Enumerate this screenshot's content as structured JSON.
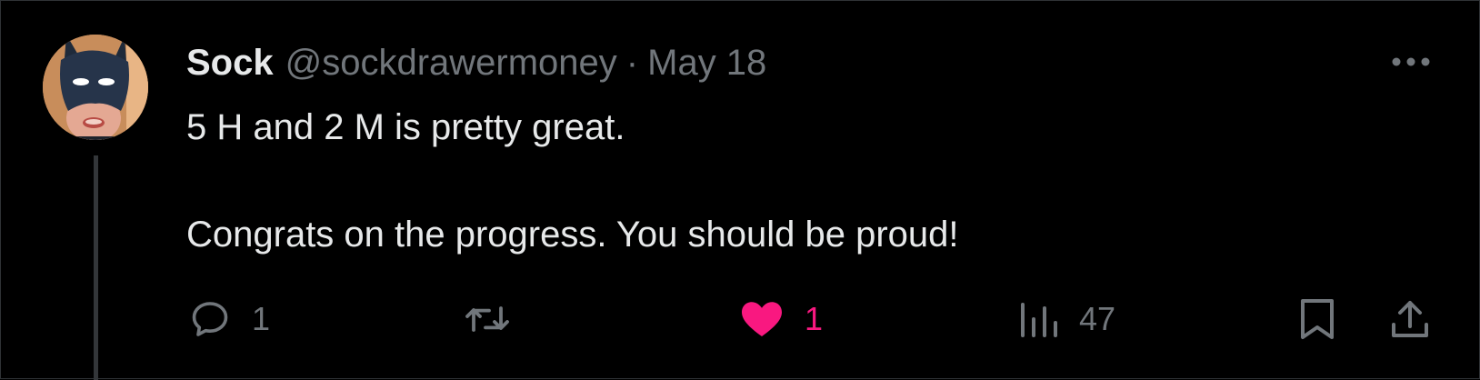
{
  "tweet": {
    "author": {
      "display_name": "Sock",
      "handle": "@sockdrawermoney",
      "avatar_icon": "masked-face-avatar"
    },
    "separator": "·",
    "date": "May 18",
    "text_lines": [
      "5 H and 2 M is pretty great.",
      "Congrats on the progress. You should be proud!"
    ],
    "actions": {
      "reply": {
        "icon": "speech-bubble-icon",
        "count": "1"
      },
      "retweet": {
        "icon": "retweet-arrows-icon",
        "count": ""
      },
      "like": {
        "icon": "heart-icon",
        "count": "1",
        "liked": true
      },
      "views": {
        "icon": "bar-chart-icon",
        "count": "47"
      },
      "bookmark": {
        "icon": "bookmark-icon"
      },
      "share": {
        "icon": "share-upload-icon"
      }
    }
  },
  "colors": {
    "background": "#000000",
    "primary_text": "#e7e9ea",
    "secondary_text": "#71767b",
    "like_active": "#f91880",
    "thread_line": "#333639"
  }
}
